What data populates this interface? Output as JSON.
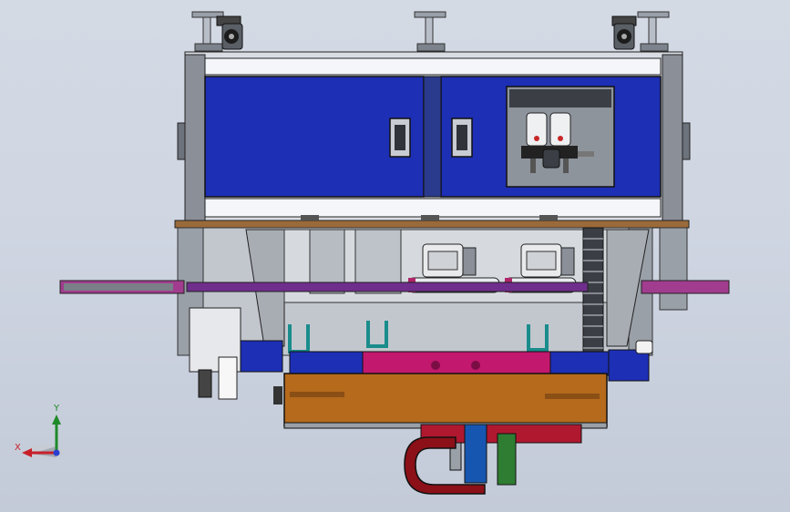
{
  "view": {
    "background_top": "#d4dae4",
    "background_bottom": "#c3cad8"
  },
  "colors": {
    "cabinet_blue": "#1d2fb5",
    "frame_gray": "#8a8f98",
    "panel_white": "#f4f6fa",
    "plate_brown": "#b56a1c",
    "plate_magenta": "#c2186e",
    "hose_red": "#8c1018",
    "mount_green": "#2e7d32",
    "accent_teal": "#1a8c8c",
    "counterweight_blue": "#1756b0"
  },
  "triad": {
    "x_label": "X",
    "y_label": "Y",
    "x_color": "#c8202a",
    "y_color": "#1f8a2a",
    "z_color": "#2a3fcf"
  },
  "icons": {
    "leveling_foot": "leveling-foot-icon",
    "caster_wheel": "caster-wheel-icon",
    "door_handle": "door-handle-icon",
    "filter_regulator": "filter-regulator-icon",
    "motor": "motor-icon",
    "drag_chain": "drag-chain-icon",
    "coordinate_triad": "coordinate-triad-icon"
  }
}
